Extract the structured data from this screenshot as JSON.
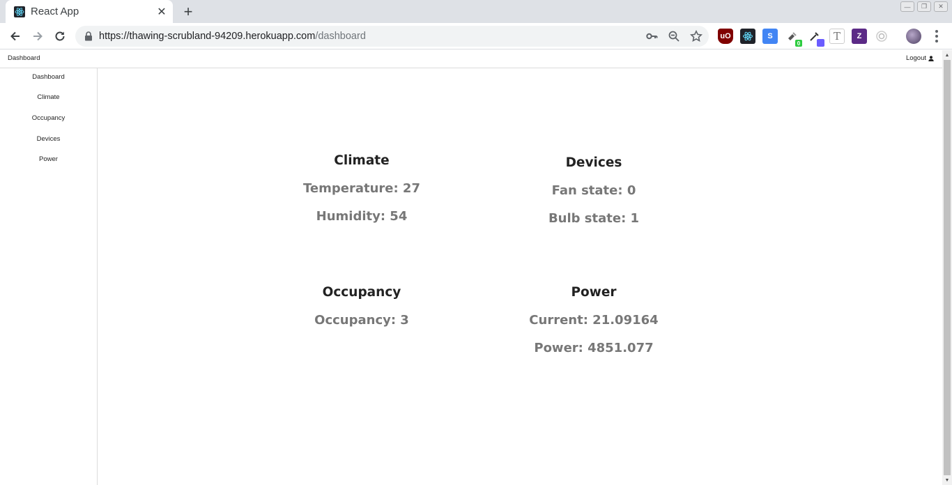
{
  "browser": {
    "tab_title": "React App",
    "url_host": "https://thawing-scrubland-94209.herokuapp.com",
    "url_path": "/dashboard"
  },
  "app": {
    "brand": "Dashboard",
    "logout_label": "Logout"
  },
  "sidebar": {
    "items": [
      {
        "label": "Dashboard"
      },
      {
        "label": "Climate"
      },
      {
        "label": "Occupancy"
      },
      {
        "label": "Devices"
      },
      {
        "label": "Power"
      }
    ]
  },
  "cards": {
    "climate": {
      "title": "Climate",
      "lines": [
        "Temperature: 27",
        "Humidity: 54"
      ]
    },
    "devices": {
      "title": "Devices",
      "lines": [
        "Fan state: 0",
        "Bulb state: 1"
      ]
    },
    "occupancy": {
      "title": "Occupancy",
      "lines": [
        "Occupancy: 3"
      ]
    },
    "power": {
      "title": "Power",
      "lines": [
        "Current: 21.09164",
        "Power: 4851.077"
      ]
    }
  },
  "extensions": {
    "badge_count": "0"
  },
  "colors": {
    "heading": "#222222",
    "value_text": "#777777",
    "chrome_bg": "#dee1e6"
  }
}
